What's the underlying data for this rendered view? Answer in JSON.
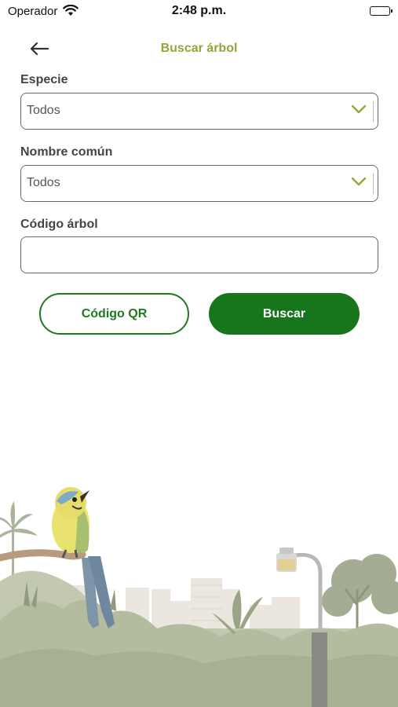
{
  "status_bar": {
    "carrier": "Operador",
    "time": "2:48 p.m."
  },
  "header": {
    "title": "Buscar árbol",
    "back_icon": "arrow-left-icon"
  },
  "form": {
    "especie": {
      "label": "Especie",
      "value": "Todos"
    },
    "nombre_comun": {
      "label": "Nombre común",
      "value": "Todos"
    },
    "codigo_arbol": {
      "label": "Código árbol",
      "value": ""
    }
  },
  "buttons": {
    "qr_label": "Código QR",
    "search_label": "Buscar"
  },
  "colors": {
    "accent": "#8fa83a",
    "primary": "#17751c",
    "chevron": "#8fa83a"
  }
}
